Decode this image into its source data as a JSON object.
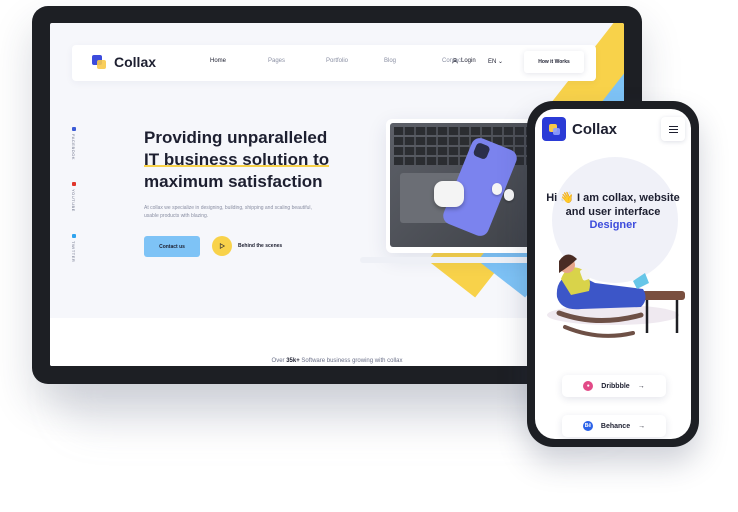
{
  "desktop": {
    "brand": "Collax",
    "nav": [
      "Home",
      "Pages",
      "Portfolio",
      "Blog",
      "Contact"
    ],
    "login": "Login",
    "lang": "EN",
    "how_it_works": "How it Works",
    "social": [
      "FACEBOOK",
      "YOUTUBE",
      "TWITTER"
    ],
    "hero_title_1": "Providing unparalleled",
    "hero_title_2": "IT business solution to",
    "hero_title_3": "maximum satisfaction",
    "hero_desc": "At collax we specialize in designing, building, shipping and scaling beautiful, usable products with blazing.",
    "contact_btn": "Contact us",
    "behind_scenes": "Behind the scenes",
    "over_prefix": "Over",
    "over_count": "35k+",
    "over_suffix": "Software business growing with collax"
  },
  "mobile": {
    "brand": "Collax",
    "hi_line1": "Hi 👋 I am collax, website",
    "hi_line2": "and user interface",
    "hi_line3": "Designer",
    "links": [
      "Dribbble",
      "Behance"
    ],
    "arrow": "→"
  },
  "colors": {
    "accent_blue": "#3c4bdc",
    "yellow": "#f8d24a",
    "light_blue": "#7ec3f6"
  }
}
